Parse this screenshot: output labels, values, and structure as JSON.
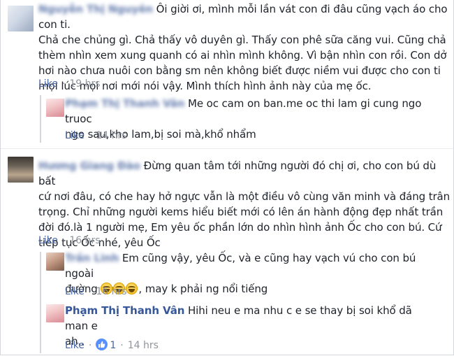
{
  "comments": [
    {
      "author": "Nguyễn Thị Nguyên",
      "text": "Ôi giời ơi, mình mỗi lần vát con đi đâu cũng vạch áo cho con ti.\nChả che chủng gì. Chả thấy vô duyên gì. Thấy con phê sữa căng vui. Cũng chả\nthèm nhìn xem xung quanh có ai nhìn mình không. Vì bận nhìn con rồi. Con dở\nhơi nào chưa nuôi con bằng sm nên không biết được niềm vui được cho con ti\nmọi lúc mọi nơi mới nói vậy. Mình thích hình ảnh này của mẹ ốc.",
      "like_label": "Like",
      "time": "19 hrs",
      "avatar_colors": [
        "#cfd8e6",
        "#9aa8bf",
        "#e9edf3"
      ]
    },
    {
      "author": "Phạm Thị Thanh Vân",
      "text": "Me oc cam on ban.me oc thi lam gi cung ngo truoc\nngo sau,kho lam,bị soi mà,khổ nhẩm",
      "like_label": "Like",
      "time": "14 hrs",
      "avatar_colors": [
        "#f2c6c8",
        "#d98a93",
        "#fbe7e8"
      ]
    },
    {
      "author": "Hương Giang Đào",
      "text": "Đừng quan tâm tới những người đó chị ơi, cho con bú dù bất\ncứ nơi đâu, có che hay hở ngực vẫn là một điều vô cùng văn minh và đáng trân\ntrọng. Chỉ những người kems hiểu biết mới có lên án hành động đẹp nhất trần\nđời đó.là 1 người mẹ, Em yêu ốc phần lớn do nhìn hình ảnh Ốc cho con bú. Cứ\ntiếp tục Ốc nhé, yêu Ốc",
      "like_label": "Like",
      "time": "16 hrs",
      "avatar_colors": [
        "#6b6258",
        "#b8a58d",
        "#3d3833"
      ]
    },
    {
      "author": "Trần Linh",
      "text_line1": "Em cũng vậy, yêu Ốc, và e cũng hay vạch vú cho con bú ngoài",
      "text_line2": "đường",
      "text_line2_after": ", may k phải ng nổi tiếng",
      "like_label": "Like",
      "time": "16 hrs",
      "avatar_colors": [
        "#c49a84",
        "#7c5a4a",
        "#e8d2c4"
      ]
    },
    {
      "author": "Phạm Thị Thanh Vân",
      "text": "Hihi neu e ma nhu c e se thay bị soi khổ dã man e\nah..",
      "like_label": "Like",
      "like_count": "1",
      "time": "14 hrs",
      "avatar_colors": [
        "#f2c6c8",
        "#d98a93",
        "#fbe7e8"
      ]
    }
  ],
  "dot": "·"
}
